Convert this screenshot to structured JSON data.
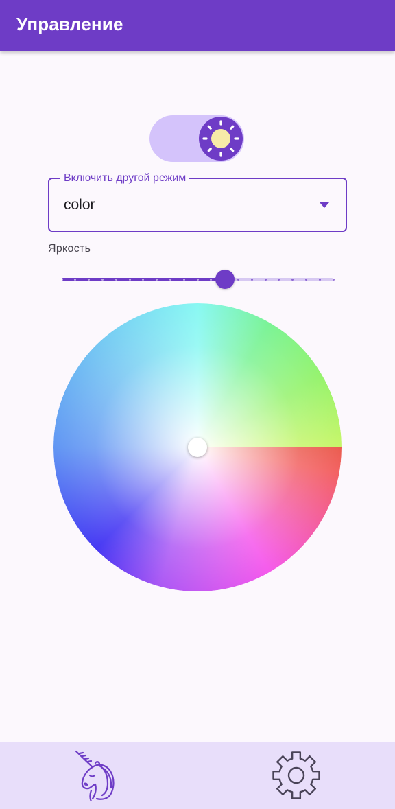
{
  "app_bar": {
    "title": "Управление"
  },
  "mode_toggle": {
    "state": "on",
    "icon": "sun-icon"
  },
  "mode_select": {
    "label": "Включить другой режим",
    "selected": "color"
  },
  "brightness": {
    "label": "Яркость",
    "value": 0.6,
    "steps": 20
  },
  "color_picker": {
    "type": "hue-saturation-wheel",
    "selected_color": "#ffffff"
  },
  "bottom_nav": {
    "items": [
      {
        "icon": "unicorn-icon"
      },
      {
        "icon": "settings-gear-icon"
      }
    ]
  },
  "colors": {
    "primary": "#6e3cc6",
    "track_light": "#d4c3fb",
    "sun_fill": "#f7eaa8",
    "nav_background": "#e8defa",
    "background": "#fcf8fd"
  }
}
